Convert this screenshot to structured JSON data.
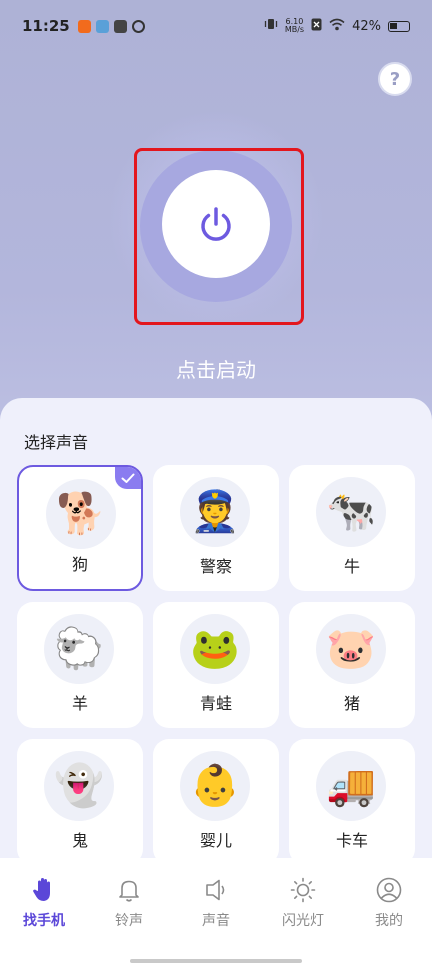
{
  "status": {
    "time": "11:25",
    "speed_top": "6.10",
    "speed_unit": "MB/s",
    "battery": "42%"
  },
  "help_button": "?",
  "start_label": "点击启动",
  "sound_section": {
    "title": "选择声音",
    "selected": "狗",
    "items": [
      {
        "label": "狗",
        "icon": "dog-icon",
        "emoji": "🐕"
      },
      {
        "label": "警察",
        "icon": "police-icon",
        "emoji": "👮"
      },
      {
        "label": "牛",
        "icon": "cow-icon",
        "emoji": "🐄"
      },
      {
        "label": "羊",
        "icon": "sheep-icon",
        "emoji": "🐑"
      },
      {
        "label": "青蛙",
        "icon": "frog-icon",
        "emoji": "🐸"
      },
      {
        "label": "猪",
        "icon": "pig-icon",
        "emoji": "🐷"
      },
      {
        "label": "鬼",
        "icon": "ghost-icon",
        "emoji": "👻"
      },
      {
        "label": "婴儿",
        "icon": "baby-icon",
        "emoji": "👶"
      },
      {
        "label": "卡车",
        "icon": "truck-icon",
        "emoji": "🚚"
      }
    ]
  },
  "tabs": [
    {
      "label": "找手机",
      "icon": "hand-icon",
      "active": true
    },
    {
      "label": "铃声",
      "icon": "bell-icon",
      "active": false
    },
    {
      "label": "声音",
      "icon": "speaker-icon",
      "active": false
    },
    {
      "label": "闪光灯",
      "icon": "flashlight-icon",
      "active": false
    },
    {
      "label": "我的",
      "icon": "profile-icon",
      "active": false
    }
  ],
  "colors": {
    "accent": "#5b47d8",
    "highlight_box": "#e3161d",
    "power_icon": "#6d5ae0"
  }
}
